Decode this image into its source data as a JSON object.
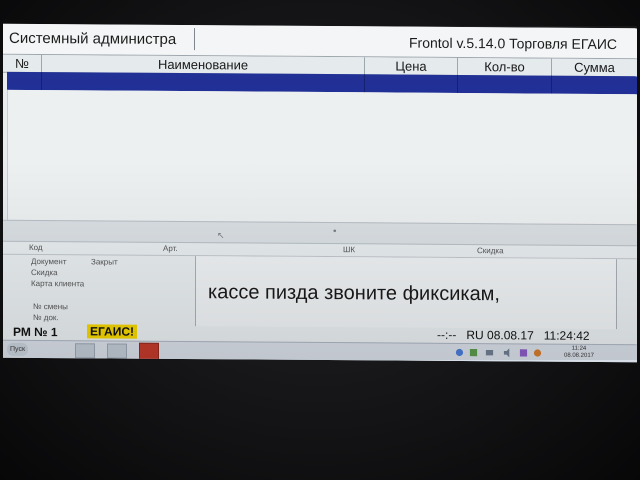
{
  "window": {
    "user": "Системный администра",
    "app_title": "Frontol v.5.14.0 Торговля ЕГАИС"
  },
  "table": {
    "columns": [
      "№",
      "Наименование",
      "Цена",
      "Кол-во",
      "Сумма"
    ],
    "rows": []
  },
  "info_header": {
    "code": "Код",
    "art": "Арт.",
    "barcode": "ШК",
    "discount": "Скидка"
  },
  "document_panel": {
    "document_label": "Документ",
    "document_status": "Закрыт",
    "discount_label": "Скидка",
    "client_card_label": "Карта клиента",
    "shift_label": "№ смены",
    "doc_no_label": "№ док."
  },
  "message": "кассе пизда звоните  фиксикам,",
  "status": {
    "workstation_prefix": "РМ № 1",
    "egais_badge": "ЕГАИС!",
    "separator": "--:--",
    "language": "RU",
    "date": "08.08.17",
    "time": "11:24:42"
  },
  "taskbar": {
    "start_label": "Пуск",
    "clock_time": "11:24",
    "clock_date": "08.08.2017"
  },
  "colors": {
    "selection": "#1b2a93",
    "egais_badge": "#f2d400",
    "screen_bg": "#e7ecef"
  }
}
